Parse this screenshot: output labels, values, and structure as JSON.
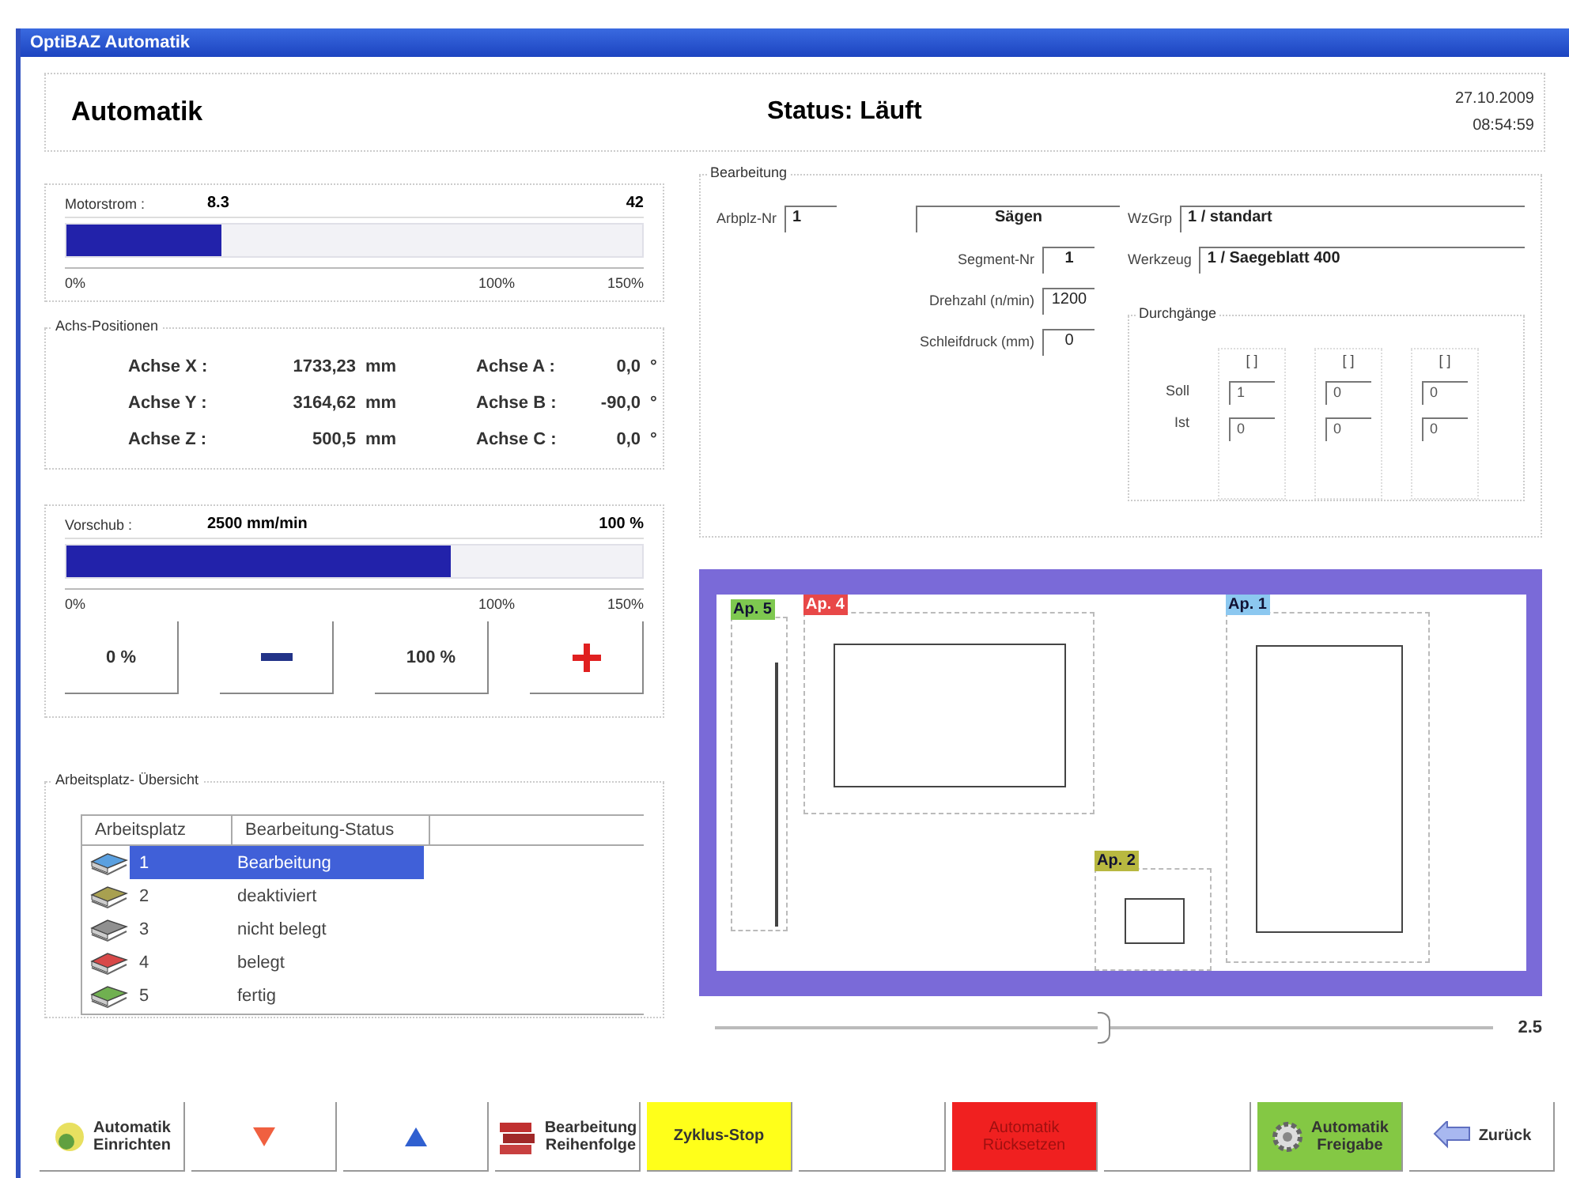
{
  "window": {
    "title": "OptiBAZ Automatik"
  },
  "header": {
    "title": "Automatik",
    "status": "Status: Läuft",
    "date": "27.10.2009",
    "time": "08:54:59"
  },
  "motor": {
    "label": "Motorstrom :",
    "value": "8.3",
    "max": "42",
    "level": 0.27,
    "ticks": [
      "0%",
      "100%",
      "150%"
    ]
  },
  "axes": {
    "title": "Achs-Positionen",
    "items": [
      {
        "label": "Achse X :",
        "value": "1733,23",
        "unit": "mm"
      },
      {
        "label": "Achse A :",
        "value": "0,0",
        "unit": "°"
      },
      {
        "label": "Achse Y :",
        "value": "3164,62",
        "unit": "mm"
      },
      {
        "label": "Achse B :",
        "value": "-90,0",
        "unit": "°"
      },
      {
        "label": "Achse Z :",
        "value": "500,5",
        "unit": "mm"
      },
      {
        "label": "Achse C :",
        "value": "0,0",
        "unit": "°"
      }
    ]
  },
  "feed": {
    "label": "Vorschub :",
    "value": "2500 mm/min",
    "percent": "100 %",
    "level": 0.667,
    "ticks": [
      "0%",
      "100%",
      "150%"
    ],
    "buttons": [
      {
        "kind": "text",
        "label": "0 %"
      },
      {
        "kind": "minus"
      },
      {
        "kind": "text",
        "label": "100 %"
      },
      {
        "kind": "plus"
      }
    ]
  },
  "overview": {
    "title": "Arbeitsplatz- Übersicht",
    "columns": [
      "Arbeitsplatz",
      "Bearbeitung-Status"
    ],
    "rows": [
      {
        "number": "1",
        "status": "Bearbeitung",
        "color": "#5aa0e0",
        "selected": true
      },
      {
        "number": "2",
        "status": "deaktiviert",
        "color": "#a8a050",
        "selected": false
      },
      {
        "number": "3",
        "status": "nicht belegt",
        "color": "#909090",
        "selected": false
      },
      {
        "number": "4",
        "status": "belegt",
        "color": "#d84848",
        "selected": false
      },
      {
        "number": "5",
        "status": "fertig",
        "color": "#70b050",
        "selected": false
      }
    ]
  },
  "processing": {
    "title": "Bearbeitung",
    "arbplz_label": "Arbplz-Nr",
    "arbplz": "1",
    "operation": "Sägen",
    "segment_label": "Segment-Nr",
    "segment": "1",
    "speed_label": "Drehzahl (n/min)",
    "speed": "1200",
    "pressure_label": "Schleifdruck (mm)",
    "pressure": "0",
    "group_label": "WzGrp",
    "group": "1 / standart",
    "tool_label": "Werkzeug",
    "tool": "1 / Saegeblatt 400",
    "passes": {
      "title": "Durchgänge",
      "soll_label": "Soll",
      "ist_label": "Ist",
      "columns": [
        {
          "header": "[ ]",
          "soll": "1",
          "ist": "0"
        },
        {
          "header": "[ ]",
          "soll": "0",
          "ist": "0"
        },
        {
          "header": "[ ]",
          "soll": "0",
          "ist": "0"
        }
      ]
    }
  },
  "table_view": {
    "workplaces": [
      {
        "label": "Ap. 5",
        "color": "#7ec850"
      },
      {
        "label": "Ap. 4",
        "color": "#e84848"
      },
      {
        "label": "Ap. 1",
        "color": "#8cc8f0"
      },
      {
        "label": "Ap. 2",
        "color": "#b8b840"
      }
    ],
    "zoom": {
      "level": 0.5,
      "reading": "2.5"
    }
  },
  "toolbar": [
    {
      "kind": "setup",
      "label": "Automatik\nEinrichten"
    },
    {
      "kind": "down"
    },
    {
      "kind": "up"
    },
    {
      "kind": "order",
      "label": "Bearbeitung\nReihenfolge"
    },
    {
      "kind": "stop",
      "label": "Zyklus-Stop",
      "color": "#ffff1a"
    },
    {
      "kind": "empty"
    },
    {
      "kind": "reset",
      "label": "Automatik\nRücksetzen",
      "color": "#f02020",
      "disabled": true
    },
    {
      "kind": "empty"
    },
    {
      "kind": "release",
      "label": "Automatik\nFreigabe",
      "color": "#84c844"
    },
    {
      "kind": "back",
      "label": "Zurück"
    }
  ]
}
